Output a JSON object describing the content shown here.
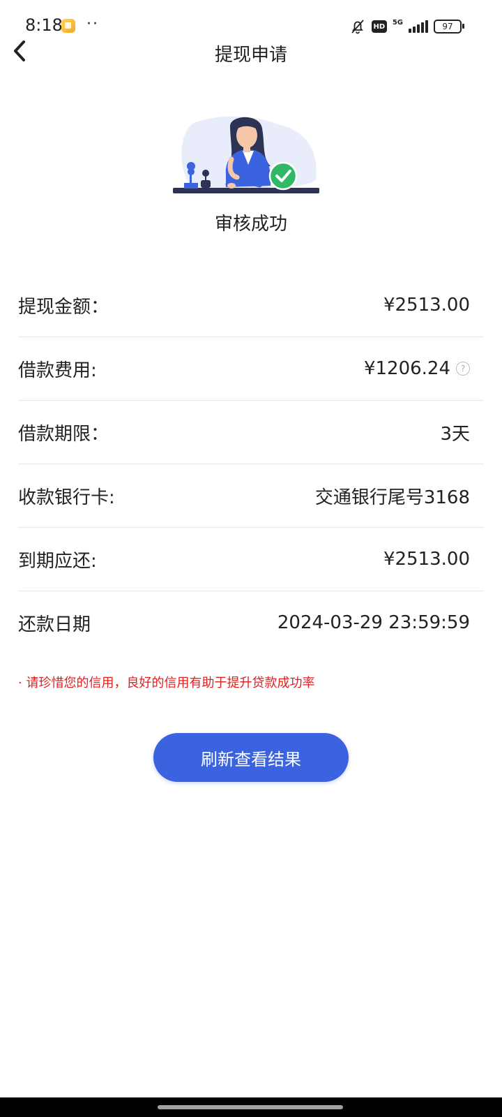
{
  "status_bar": {
    "time": "8:18",
    "dots": "··",
    "hd": "HD",
    "network": "5G",
    "battery": "97"
  },
  "header": {
    "title": "提现申请"
  },
  "result": {
    "status_text": "审核成功",
    "accent_color": "#2fb866"
  },
  "info": [
    {
      "label": "提现金额：",
      "value": "¥2513.00"
    },
    {
      "label": "借款费用:",
      "value": "¥1206.24"
    },
    {
      "label": "借款期限：",
      "value": "3天"
    },
    {
      "label": "收款银行卡:",
      "value": "交通银行尾号3168"
    },
    {
      "label": "到期应还:",
      "value": "¥2513.00"
    },
    {
      "label": "还款日期",
      "value": "2024-03-29 23:59:59"
    }
  ],
  "notice": "· 请珍惜您的信用，良好的信用有助于提升贷款成功率",
  "buttons": {
    "refresh": "刷新查看结果"
  },
  "colors": {
    "primary": "#3b63e0",
    "notice": "#e02020"
  }
}
